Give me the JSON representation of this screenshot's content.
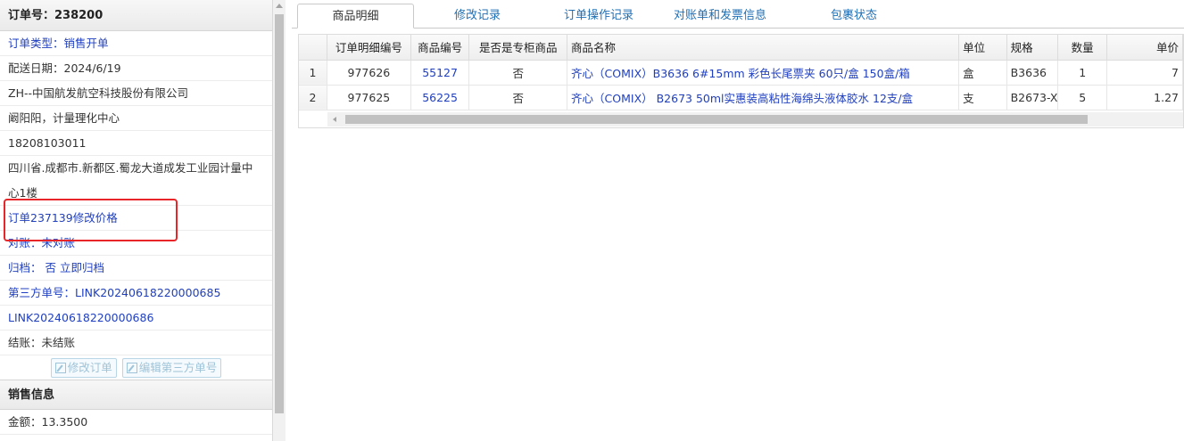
{
  "order": {
    "title": "订单号：238200",
    "type": "订单类型：销售开单",
    "delivery_date": "配送日期：2024/6/19",
    "company": "ZH--中国航发航空科技股份有限公司",
    "contact": "阚阳阳，计量理化中心",
    "phone": "18208103011",
    "address": "四川省.成都市.新都区.蜀龙大道成发工业园计量中心1楼",
    "remark_link": "订单237139修改价格",
    "reconcile": "对账：未对账",
    "archive_label": "归档：",
    "archive_value": "否",
    "archive_action": "立即归档",
    "third_party_1": "第三方单号：LINK20240618220000685",
    "third_party_2": "LINK20240618220000686",
    "settlement": "结账：未结账",
    "edit_order_btn": "修改订单",
    "edit_third_btn": "编辑第三方单号"
  },
  "sales": {
    "title": "销售信息",
    "amount": "金额：13.3500"
  },
  "tabs": [
    "商品明细",
    "修改记录",
    "订单操作记录",
    "对账单和发票信息",
    "包裹状态"
  ],
  "table": {
    "headers": [
      "",
      "订单明细编号",
      "商品编号",
      "是否是专柜商品",
      "商品名称",
      "单位",
      "规格",
      "数量",
      "单价"
    ],
    "rows": [
      {
        "no": "1",
        "detail_id": "977626",
        "product_id": "55127",
        "counter": "否",
        "name": "齐心（COMIX）B3636 6#15mm 彩色长尾票夹 60只/盒 150盒/箱",
        "unit": "盒",
        "spec": "B3636",
        "qty": "1",
        "price": "7"
      },
      {
        "no": "2",
        "detail_id": "977625",
        "product_id": "56225",
        "counter": "否",
        "name": "齐心（COMIX） B2673 50ml实惠装高粘性海绵头液体胶水 12支/盒",
        "unit": "支",
        "spec": "B2673-X",
        "qty": "5",
        "price": "1.27"
      }
    ]
  },
  "colors": {
    "link": "#1f3fbf",
    "tab_link": "#1f6fb5",
    "highlight_box": "#e8262a"
  }
}
